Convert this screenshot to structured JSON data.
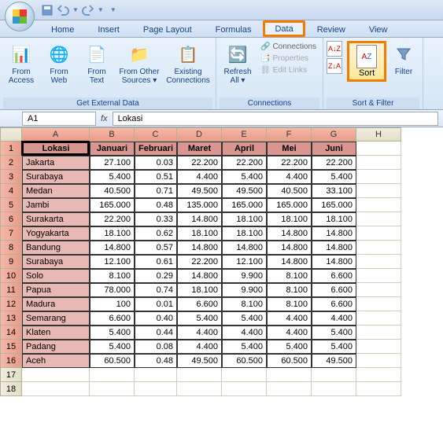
{
  "qat": {
    "save": "Save",
    "undo": "Undo",
    "redo": "Redo"
  },
  "tabs": {
    "home": "Home",
    "insert": "Insert",
    "pagelayout": "Page Layout",
    "formulas": "Formulas",
    "data": "Data",
    "review": "Review",
    "view": "View"
  },
  "ribbon": {
    "ext": {
      "title": "Get External Data",
      "access": "From Access",
      "web": "From Web",
      "text": "From Text",
      "other": "From Other Sources ▾",
      "existing": "Existing Connections"
    },
    "conn": {
      "title": "Connections",
      "refresh": "Refresh All ▾",
      "connections": "Connections",
      "properties": "Properties",
      "edit": "Edit Links"
    },
    "sort": {
      "title": "Sort & Filter",
      "sort": "Sort",
      "filter": "Filter",
      "az": "A→Z",
      "za": "Z→A"
    }
  },
  "namebox": "A1",
  "formula": "Lokasi",
  "cols": [
    "A",
    "B",
    "C",
    "D",
    "E",
    "F",
    "G",
    "H"
  ],
  "headers": [
    "Lokasi",
    "Januari",
    "Februari",
    "Maret",
    "April",
    "Mei",
    "Juni"
  ],
  "rows": [
    {
      "loc": "Jakarta",
      "v": [
        "27.100",
        "0.03",
        "22.200",
        "22.200",
        "22.200",
        "22.200"
      ]
    },
    {
      "loc": "Surabaya",
      "v": [
        "5.400",
        "0.51",
        "4.400",
        "5.400",
        "4.400",
        "5.400"
      ]
    },
    {
      "loc": "Medan",
      "v": [
        "40.500",
        "0.71",
        "49.500",
        "49.500",
        "40.500",
        "33.100"
      ]
    },
    {
      "loc": "Jambi",
      "v": [
        "165.000",
        "0.48",
        "135.000",
        "165.000",
        "165.000",
        "165.000"
      ]
    },
    {
      "loc": "Surakarta",
      "v": [
        "22.200",
        "0.33",
        "14.800",
        "18.100",
        "18.100",
        "18.100"
      ]
    },
    {
      "loc": "Yogyakarta",
      "v": [
        "18.100",
        "0.62",
        "18.100",
        "18.100",
        "14.800",
        "14.800"
      ]
    },
    {
      "loc": "Bandung",
      "v": [
        "14.800",
        "0.57",
        "14.800",
        "14.800",
        "14.800",
        "14.800"
      ]
    },
    {
      "loc": "Surabaya",
      "v": [
        "12.100",
        "0.61",
        "22.200",
        "12.100",
        "14.800",
        "14.800"
      ]
    },
    {
      "loc": "Solo",
      "v": [
        "8.100",
        "0.29",
        "14.800",
        "9.900",
        "8.100",
        "6.600"
      ]
    },
    {
      "loc": "Papua",
      "v": [
        "78.000",
        "0.74",
        "18.100",
        "9.900",
        "8.100",
        "6.600"
      ]
    },
    {
      "loc": "Madura",
      "v": [
        "100",
        "0.01",
        "6.600",
        "8.100",
        "8.100",
        "6.600"
      ]
    },
    {
      "loc": "Semarang",
      "v": [
        "6.600",
        "0.40",
        "5.400",
        "5.400",
        "4.400",
        "4.400"
      ]
    },
    {
      "loc": "Klaten",
      "v": [
        "5.400",
        "0.44",
        "4.400",
        "4.400",
        "4.400",
        "5.400"
      ]
    },
    {
      "loc": "Padang",
      "v": [
        "5.400",
        "0.08",
        "4.400",
        "5.400",
        "5.400",
        "5.400"
      ]
    },
    {
      "loc": "Aceh",
      "v": [
        "60.500",
        "0.48",
        "49.500",
        "60.500",
        "60.500",
        "49.500"
      ]
    }
  ]
}
